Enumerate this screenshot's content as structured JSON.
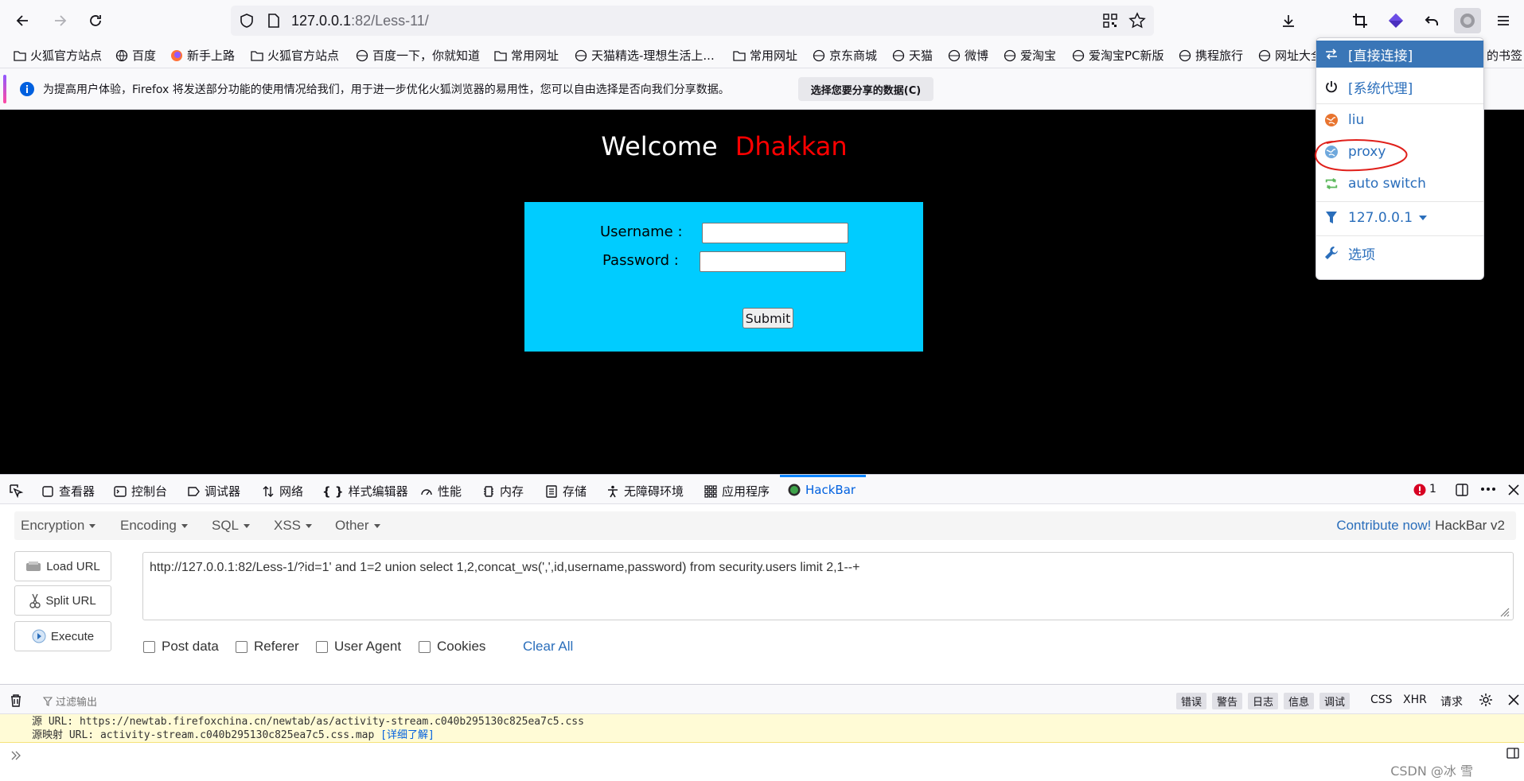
{
  "browser": {
    "url_host": "127.0.0.1",
    "url_rest": ":82/Less-11/"
  },
  "bookmarks": [
    {
      "label": "火狐官方站点",
      "icon": "folder-icon"
    },
    {
      "label": "百度",
      "icon": "globe-icon"
    },
    {
      "label": "新手上路",
      "icon": "firefox-icon"
    },
    {
      "label": "火狐官方站点",
      "icon": "folder-icon"
    },
    {
      "label": "百度一下，你就知道",
      "icon": "globe-icon"
    },
    {
      "label": "常用网址",
      "icon": "folder-icon"
    },
    {
      "label": "天猫精选-理想生活上...",
      "icon": "globe-icon"
    },
    {
      "label": "常用网址",
      "icon": "folder-icon"
    },
    {
      "label": "京东商城",
      "icon": "globe-icon"
    },
    {
      "label": "天猫",
      "icon": "globe-icon"
    },
    {
      "label": "微博",
      "icon": "globe-icon"
    },
    {
      "label": "爱淘宝",
      "icon": "globe-icon"
    },
    {
      "label": "爱淘宝PC新版",
      "icon": "globe-icon"
    },
    {
      "label": "携程旅行",
      "icon": "globe-icon"
    },
    {
      "label": "网址大全",
      "icon": "globe-icon"
    },
    {
      "label": "的书签",
      "icon": ""
    }
  ],
  "notification": {
    "text": "为提高用户体验，Firefox 将发送部分功能的使用情况给我们，用于进一步优化火狐浏览器的易用性，您可以自由选择是否向我们分享数据。",
    "button": "选择您要分享的数据(C)"
  },
  "page": {
    "welcome": "Welcome",
    "name": "Dhakkan",
    "username_label": "Username :",
    "password_label": "Password :",
    "submit": "Submit"
  },
  "devtools": {
    "tabs": [
      "查看器",
      "控制台",
      "调试器",
      "网络",
      "样式编辑器",
      "性能",
      "内存",
      "存储",
      "无障碍环境",
      "应用程序",
      "HackBar"
    ],
    "error_count": "1"
  },
  "hackbar": {
    "menus": [
      "Encryption",
      "Encoding",
      "SQL",
      "XSS",
      "Other"
    ],
    "contribute_link": "Contribute now!",
    "version": "HackBar v2",
    "buttons": {
      "load": "Load URL",
      "split": "Split URL",
      "execute": "Execute"
    },
    "url_value": "http://127.0.0.1:82/Less-1/?id=1' and 1=2 union select 1,2,concat_ws(',',id,username,password) from security.users limit 2,1--+",
    "options": [
      "Post data",
      "Referer",
      "User Agent",
      "Cookies"
    ],
    "clear_all": "Clear All"
  },
  "console": {
    "filter_placeholder": "过滤输出",
    "filters": [
      "错误",
      "警告",
      "日志",
      "信息",
      "调试"
    ],
    "extra_filters": [
      "CSS",
      "XHR",
      "请求"
    ],
    "msg_line1": "源 URL: https://newtab.firefoxchina.cn/newtab/as/activity-stream.c040b295130c825ea7c5.css",
    "msg_line2_prefix": "源映射 URL: activity-stream.c040b295130c825ea7c5.css.map",
    "msg_link": "[详细了解]"
  },
  "proxy_menu": {
    "items": [
      {
        "label": "[直接连接]",
        "icon": "direct-connect-icon"
      },
      {
        "label": "[系统代理]",
        "icon": "power-icon"
      },
      {
        "label": "liu",
        "icon": "globe-orange-icon"
      },
      {
        "label": "proxy",
        "icon": "globe-blue-icon"
      },
      {
        "label": "auto switch",
        "icon": "refresh-icon"
      },
      {
        "label": "127.0.0.1",
        "icon": "filter-icon"
      },
      {
        "label": "选项",
        "icon": "wrench-icon"
      }
    ]
  },
  "watermark": "CSDN @冰 雪"
}
